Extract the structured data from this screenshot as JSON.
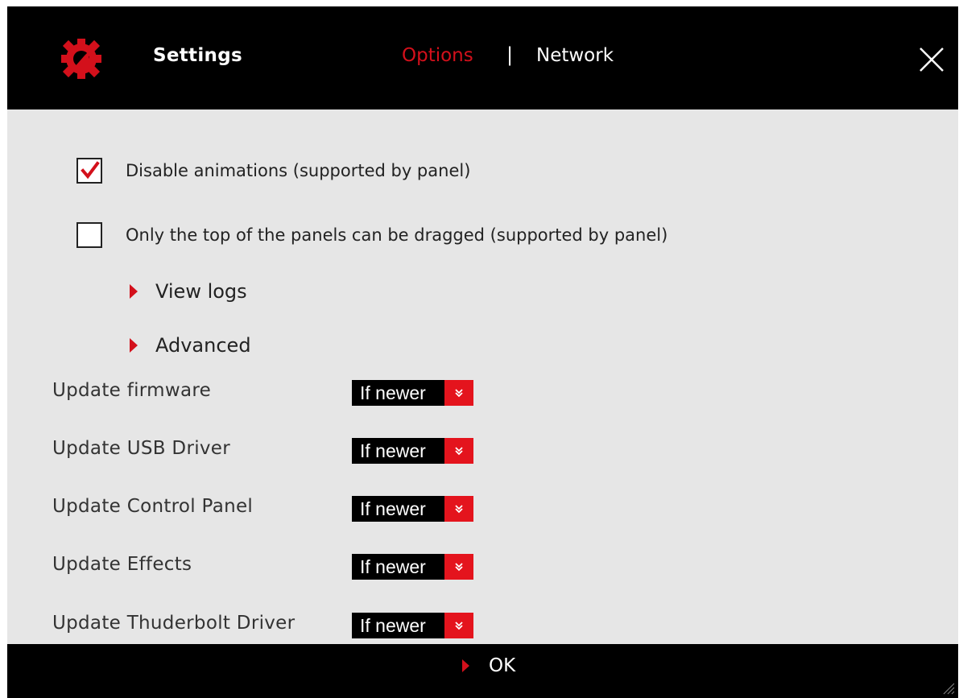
{
  "window": {
    "title": "Settings",
    "icon": "gear-wrench-icon",
    "close_icon": "close-icon"
  },
  "tabs": [
    {
      "label": "Options",
      "active": true
    },
    {
      "label": "Network",
      "active": false
    }
  ],
  "tab_separator": "|",
  "checkboxes": [
    {
      "label": "Disable animations (supported by panel)",
      "checked": true
    },
    {
      "label": "Only the top of the panels can be dragged (supported by panel)",
      "checked": false
    }
  ],
  "expanders": [
    {
      "label": "View logs"
    },
    {
      "label": "Advanced"
    }
  ],
  "update_settings": [
    {
      "label": "Update firmware",
      "value": "If newer"
    },
    {
      "label": "Update USB Driver",
      "value": "If newer"
    },
    {
      "label": "Update Control Panel",
      "value": "If newer"
    },
    {
      "label": "Update Effects",
      "value": "If newer"
    },
    {
      "label": "Update Thuderbolt Driver",
      "value": "If newer"
    }
  ],
  "footer": {
    "ok_label": "OK"
  },
  "colors": {
    "accent": "#d3101b",
    "titlebar": "#000000",
    "body": "#e6e6e6"
  }
}
